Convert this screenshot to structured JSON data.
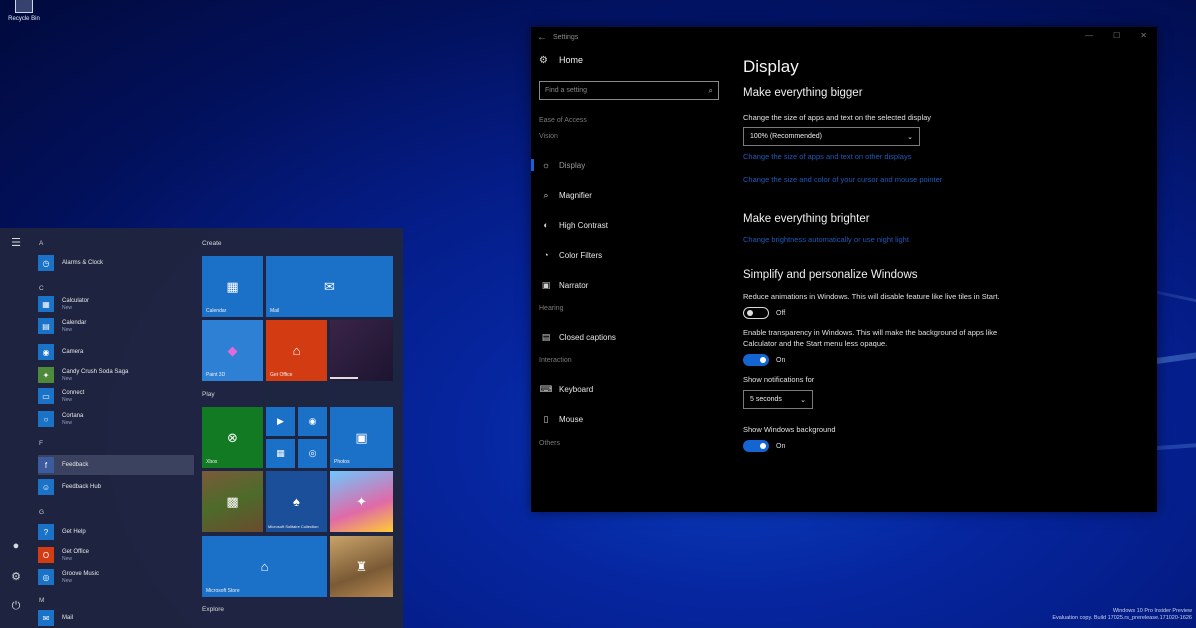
{
  "desktop": {
    "recycle_bin_label": "Recycle Bin",
    "watermark_line1": "Windows 10 Pro Insider Preview",
    "watermark_line2": "Evaluation copy. Build 17025.rs_prerelease.171020-1626"
  },
  "settings": {
    "window_title": "Settings",
    "home_label": "Home",
    "search_placeholder": "Find a setting",
    "category": "Ease of Access",
    "section_vision": "Vision",
    "section_hearing": "Hearing",
    "section_interaction": "Interaction",
    "section_others": "Others",
    "nav": {
      "display": "Display",
      "magnifier": "Magnifier",
      "high_contrast": "High Contrast",
      "color_filters": "Color Filters",
      "narrator": "Narrator",
      "closed_captions": "Closed captions",
      "keyboard": "Keyboard",
      "mouse": "Mouse"
    },
    "page_title": "Display",
    "bigger": {
      "heading": "Make everything bigger",
      "desc": "Change the size of apps and text on the selected display",
      "dropdown_value": "100% (Recommended)",
      "link1": "Change the size of apps and text on other displays",
      "link2": "Change the size and color of your cursor and mouse pointer"
    },
    "brighter": {
      "heading": "Make everything brighter",
      "link": "Change brightness automatically or use night light"
    },
    "simplify": {
      "heading": "Simplify and personalize Windows",
      "anim_desc": "Reduce animations in Windows. This will disable feature like live tiles in Start.",
      "anim_state": "Off",
      "transp_desc": "Enable transparency in Windows. This will make the background of apps like Calculator and the Start menu less opaque.",
      "transp_state": "On",
      "notif_label": "Show notifications for",
      "notif_value": "5 seconds",
      "bg_label": "Show Windows background",
      "bg_state": "On"
    }
  },
  "start": {
    "letters": {
      "a": "A",
      "c": "C",
      "f": "F",
      "g": "G",
      "m": "M"
    },
    "apps": {
      "alarms": "Alarms & Clock",
      "calculator": "Calculator",
      "calendar": "Calendar",
      "camera": "Camera",
      "candy": "Candy Crush Soda Saga",
      "connect": "Connect",
      "cortana": "Cortana",
      "feedback": "Feedback",
      "feedback_hub": "Feedback Hub",
      "get_help": "Get Help",
      "get_office": "Get Office",
      "groove": "Groove Music",
      "mail": "Mail",
      "new_badge": "New"
    },
    "groups": {
      "create": "Create",
      "play": "Play",
      "explore": "Explore"
    },
    "tiles": {
      "calendar": "Calendar",
      "mail": "Mail",
      "paint3d": "Paint 3D",
      "get_office": "Get Office",
      "xbox": "Xbox",
      "photos": "Photos",
      "solitaire": "Microsoft Solitaire Collection",
      "store": "Microsoft Store"
    }
  }
}
